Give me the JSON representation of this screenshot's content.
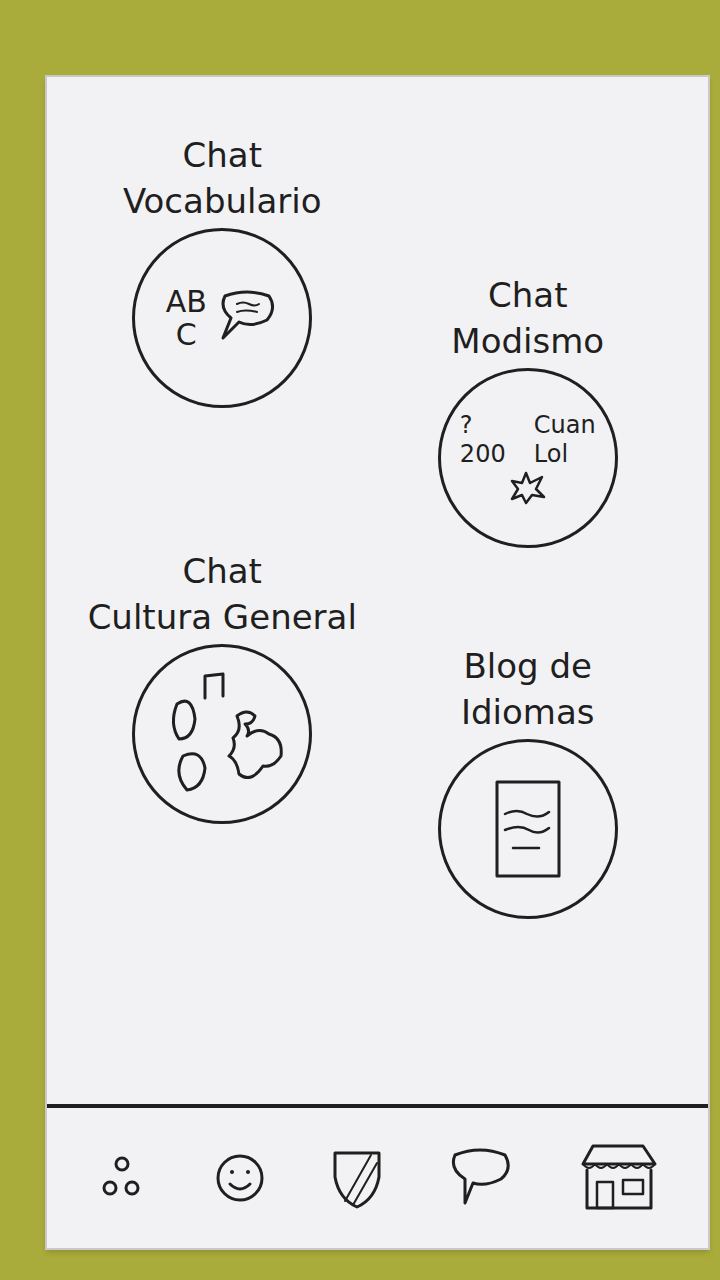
{
  "screen": {
    "tiles": [
      {
        "kind": "letters",
        "title": [
          "Chat",
          "Vocabulario"
        ],
        "marks": [
          "AB",
          "C"
        ]
      },
      {
        "kind": "slang",
        "title": [
          "Chat",
          "Modismo"
        ],
        "marks": [
          "?",
          "Cuan",
          "200",
          "Lol"
        ]
      },
      {
        "kind": "culture",
        "title": [
          "Chat",
          "Cultura General"
        ],
        "marks": []
      },
      {
        "kind": "blog",
        "title": [
          "Blog de",
          "Idiomas"
        ],
        "marks": []
      }
    ]
  }
}
